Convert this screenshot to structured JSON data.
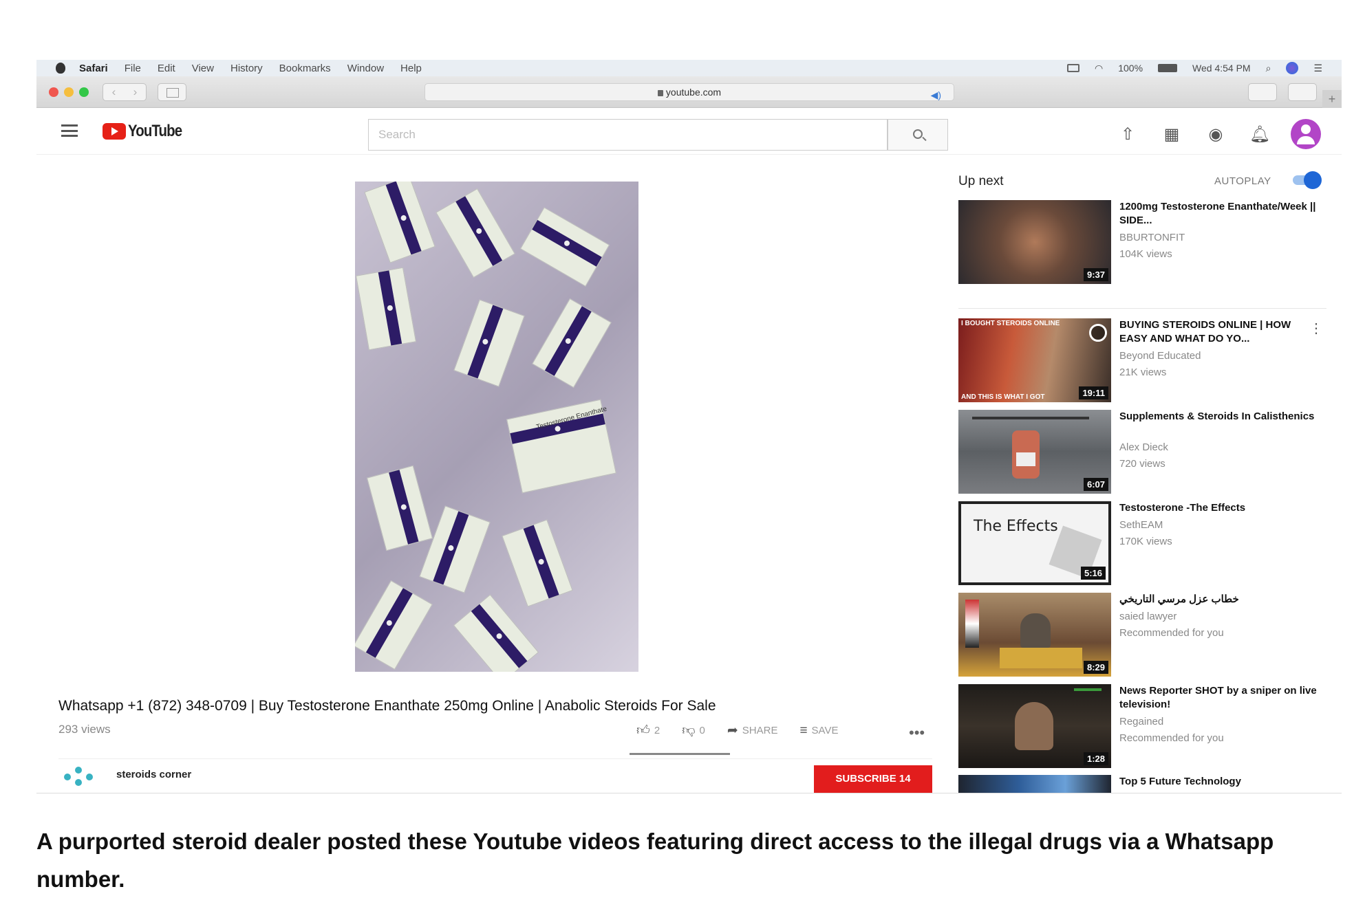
{
  "menubar": {
    "app": "Safari",
    "items": [
      "File",
      "Edit",
      "View",
      "History",
      "Bookmarks",
      "Window",
      "Help"
    ],
    "battery": "100%",
    "clock": "Wed 4:54 PM"
  },
  "browser": {
    "url": "youtube.com",
    "nav_back": "‹",
    "nav_forward": "›",
    "new_tab": "+"
  },
  "youtube": {
    "logo_text": "YouTube",
    "search_placeholder": "Search"
  },
  "video": {
    "title": "Whatsapp +1 (872) 348-0709 | Buy Testosterone Enanthate 250mg Online | Anabolic Steroids For Sale",
    "views": "293 views",
    "likes": "2",
    "dislikes": "0",
    "share_label": "SHARE",
    "save_label": "SAVE",
    "box_label": "Testosterone Enanthate",
    "channel": "steroids corner",
    "subscribe_label": "SUBSCRIBE 14"
  },
  "upnext": {
    "title": "Up next",
    "autoplay_label": "AUTOPLAY",
    "autoplay_on": true,
    "items": [
      {
        "title": "1200mg Testosterone Enanthate/Week || SIDE...",
        "channel": "BBURTONFIT",
        "meta": "104K views",
        "duration": "9:37",
        "thumb_color": "#5b4a40"
      },
      {
        "title": "BUYING STEROIDS ONLINE | HOW EASY AND WHAT DO YO...",
        "channel": "Beyond Educated",
        "meta": "21K views",
        "duration": "19:11",
        "thumb_color": "#3b2f2a",
        "thumb_top": "I BOUGHT STEROIDS ONLINE",
        "thumb_bottom": "AND THIS IS WHAT I GOT"
      },
      {
        "title": "Supplements & Steroids In Calisthenics",
        "channel": "Alex Dieck",
        "meta": "720 views",
        "duration": "6:07",
        "thumb_color": "#6c6f73"
      },
      {
        "title": "Testosterone -The Effects",
        "channel": "SethEAM",
        "meta": "170K views",
        "duration": "5:16",
        "thumb_color": "#f1f1f1",
        "thumb_text": "The Effects"
      },
      {
        "title": "خطاب عزل مرسي التاريخي",
        "channel": "saied lawyer",
        "meta": "Recommended for you",
        "duration": "8:29",
        "thumb_color": "#7a5a3a"
      },
      {
        "title": "News Reporter SHOT by a sniper on live television!",
        "channel": "Regained",
        "meta": "Recommended for you",
        "duration": "1:28",
        "thumb_color": "#2a2622"
      },
      {
        "title": "Top 5 Future Technology",
        "channel": "",
        "meta": "",
        "duration": "",
        "thumb_color": "#2f4f7a"
      }
    ]
  },
  "caption": "A purported steroid dealer posted these Youtube videos featuring direct access to the illegal drugs via a Whatsapp number."
}
